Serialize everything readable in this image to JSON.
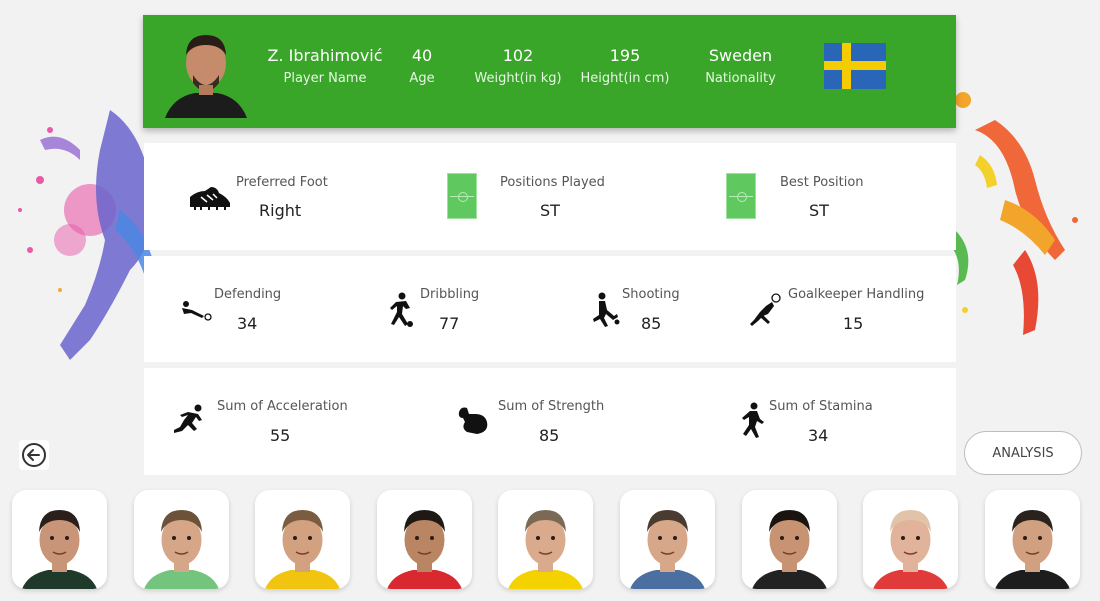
{
  "player": {
    "name": "Z. Ibrahimović",
    "name_label": "Player Name",
    "age": "40",
    "age_label": "Age",
    "weight": "102",
    "weight_label": "Weight(in kg)",
    "height": "195",
    "height_label": "Height(in cm)",
    "nationality": "Sweden",
    "nationality_label": "Nationality"
  },
  "profile": {
    "preferred_foot_label": "Preferred Foot",
    "preferred_foot": "Right",
    "positions_label": "Positions Played",
    "positions": "ST",
    "best_position_label": "Best Position",
    "best_position": "ST"
  },
  "skills": [
    {
      "label": "Defending",
      "value": "34"
    },
    {
      "label": "Dribbling",
      "value": "77"
    },
    {
      "label": "Shooting",
      "value": "85"
    },
    {
      "label": "Goalkeeper Handling",
      "value": "15"
    }
  ],
  "physical": [
    {
      "label": "Sum of Acceleration",
      "value": "55"
    },
    {
      "label": "Sum of Strength",
      "value": "85"
    },
    {
      "label": "Sum of Stamina",
      "value": "34"
    }
  ],
  "buttons": {
    "analysis": "ANALYSIS"
  },
  "icons": {
    "back": "back-arrow-circle-icon",
    "boot": "football-boot-icon",
    "pitch": "football-pitch-icon",
    "defending": "tackle-icon",
    "dribbling": "dribble-icon",
    "shooting": "shooting-icon",
    "goalkeeping": "goalkeeper-dive-icon",
    "acceleration": "sprint-icon",
    "strength": "strength-icon",
    "stamina": "runner-icon"
  },
  "colors": {
    "header_green": "#3aa629",
    "flag_blue": "#2a66b8",
    "flag_yellow": "#f5cc00",
    "pitch_green": "#5fc95f"
  },
  "thumbnails": [
    {
      "jersey": "#1f3a2a"
    },
    {
      "jersey": "#73c47c"
    },
    {
      "jersey": "#f1c40f"
    },
    {
      "jersey": "#d9282f"
    },
    {
      "jersey": "#f4d200"
    },
    {
      "jersey": "#4a6fa0"
    },
    {
      "jersey": "#222222"
    },
    {
      "jersey": "#e03a3a"
    },
    {
      "jersey": "#1d1d1d"
    }
  ]
}
